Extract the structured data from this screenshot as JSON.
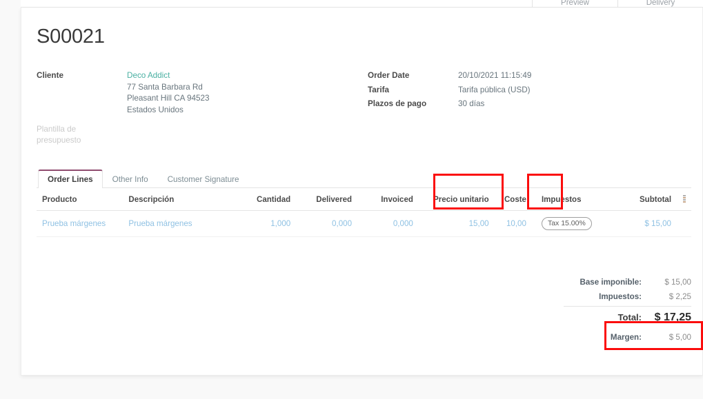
{
  "topbar": {
    "buttons": [
      {
        "label": "Preview",
        "name": "preview-button"
      },
      {
        "label": "Delivery",
        "name": "delivery-button"
      }
    ]
  },
  "document": {
    "title": "S00021"
  },
  "header_fields": {
    "left": {
      "customer_label": "Cliente",
      "customer_name": "Deco Addict",
      "address": [
        "77 Santa Barbara Rd",
        "Pleasant Hill CA 94523",
        "Estados Unidos"
      ],
      "template_label_line1": "Plantilla de",
      "template_label_line2": "presupuesto"
    },
    "right": [
      {
        "label": "Order Date",
        "value": "20/10/2021 11:15:49"
      },
      {
        "label": "Tarifa",
        "value": "Tarifa pública (USD)"
      },
      {
        "label": "Plazos de pago",
        "value": "30 días"
      }
    ]
  },
  "tabs": [
    {
      "label": "Order Lines",
      "active": true
    },
    {
      "label": "Other Info",
      "active": false
    },
    {
      "label": "Customer Signature",
      "active": false
    }
  ],
  "order_lines": {
    "columns": [
      "Producto",
      "Descripción",
      "Cantidad",
      "Delivered",
      "Invoiced",
      "Precio unitario",
      "Coste",
      "Impuestos",
      "Subtotal"
    ],
    "optional_columns_icon": "column-options-icon",
    "rows": [
      {
        "producto": "Prueba márgenes",
        "descripcion": "Prueba márgenes",
        "cantidad": "1,000",
        "delivered": "0,000",
        "invoiced": "0,000",
        "precio_unitario": "15,00",
        "coste": "10,00",
        "impuestos": "Tax 15.00%",
        "subtotal": "$ 15,00"
      }
    ]
  },
  "totals": {
    "base_label": "Base imponible:",
    "base_value": "$ 15,00",
    "taxes_label": "Impuestos:",
    "taxes_value": "$ 2,25",
    "total_label": "Total:",
    "total_value": "$ 17,25",
    "margin_label": "Margen:",
    "margin_value": "$ 5,00"
  },
  "colors": {
    "link": "#4ab0a2",
    "cell_link": "#8fc1e3",
    "active_tab_accent": "#8f4b6e",
    "annotation": "#fb0c0c"
  }
}
